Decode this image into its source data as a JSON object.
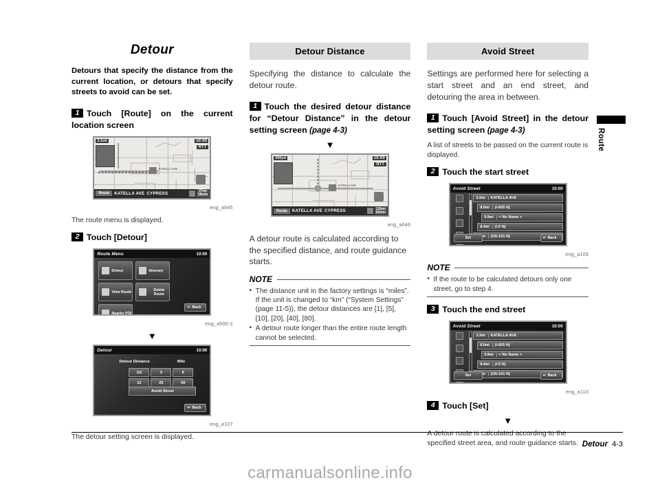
{
  "document": {
    "main_title": "Detour",
    "footer_title": "Detour",
    "footer_page": "4-3",
    "side_tab_label": "Route",
    "watermark": "carmanualsonline.info"
  },
  "left_column": {
    "intro": "Detours that specify the distance from the current location, or detours that specify streets to avoid can be set.",
    "step1": {
      "num": "1",
      "text": "Touch [Route] on the current location screen",
      "caption": "eng_a645",
      "result": "The route menu is displayed."
    },
    "step2": {
      "num": "2",
      "text": "Touch [Detour]",
      "caption1": "eng_a500-2",
      "caption2": "eng_a107",
      "result": "The detour setting screen is displayed."
    },
    "map_screen": {
      "scale": "3.1mi",
      "clock": "10:00",
      "rtt": "RTT",
      "route_button": "Route",
      "street1": "KATELLA AVE",
      "street2": "CYPRESS",
      "eta_distance": "27mi",
      "eta_time": "28min"
    },
    "route_menu_screen": {
      "title": "Route Menu",
      "clock": "10:00",
      "buttons": [
        "Detour",
        "Itinerary",
        "View Route",
        "Delete Route",
        "Nearby POI"
      ],
      "back_label": "Back"
    },
    "detour_screen": {
      "title": "Detour",
      "clock": "10:00",
      "label_distance": "Detour Distance",
      "label_unit": "Mile",
      "distances": [
        "1/2",
        "3",
        "6",
        "12",
        "25",
        "50"
      ],
      "avoid_street_label": "Avoid Street",
      "back_label": "Back"
    }
  },
  "middle_column": {
    "banner": "Detour Distance",
    "intro": "Specifying the distance to calculate the detour route.",
    "step1": {
      "num": "1",
      "text": "Touch the desired detour distance for “Detour Distance” in the detour setting screen ",
      "pageref": "(page 4-3)"
    },
    "caption": "eng_a646",
    "result": "A detour route is calculated according to the specified distance, and route guidance starts.",
    "note_title": "NOTE",
    "notes": [
      "The distance unit in the factory settings is “miles”. If the unit is changed to “km” (“System Settings” (page 11-5)), the detour distances are [1], [5], [10], [20], [40], [80].",
      "A detour route longer than the entire route length cannot be selected."
    ],
    "map_screen": {
      "scale": "300yd",
      "clock": "10:00",
      "rtt": "RTT",
      "route_button": "Route",
      "street1": "KATELLA AVE",
      "street2": "CYPRESS",
      "eta_distance": "126mi",
      "eta_time": "50min"
    }
  },
  "right_column": {
    "banner": "Avoid Street",
    "intro": "Settings are performed here for selecting a start street and an end street, and detouring the area in between.",
    "step1": {
      "num": "1",
      "text": "Touch [Avoid Street] in the detour setting screen ",
      "pageref": "(page 4-3)",
      "result": "A list of streets to be passed on the current route is displayed."
    },
    "step2": {
      "num": "2",
      "text": "Touch the start street",
      "caption": "eng_a109"
    },
    "step3": {
      "num": "3",
      "text": "Touch the end street",
      "caption": "eng_a110"
    },
    "step4": {
      "num": "4",
      "text": "Touch [Set]",
      "result": "A detour route is calculated according to the specified street area, and route guidance starts."
    },
    "note_title": "NOTE",
    "notes": [
      "If the route to be calculated detours only one street, go to step 4."
    ],
    "avoid_street_screen": {
      "title": "Avoid Street",
      "clock": "10:00",
      "rows": [
        {
          "distance": "3.3mi",
          "name": "KATELLA AVE"
        },
        {
          "distance": "8.0mi",
          "name": "(I-605 N)"
        },
        {
          "distance": "0.9mi",
          "name": "< No Name >"
        },
        {
          "distance": "8.4mi",
          "name": "(I-5 N)"
        },
        {
          "distance": "4.8mi",
          "name": "(US-101 N)"
        }
      ],
      "set_label": "Set",
      "back_label": "Back"
    }
  }
}
